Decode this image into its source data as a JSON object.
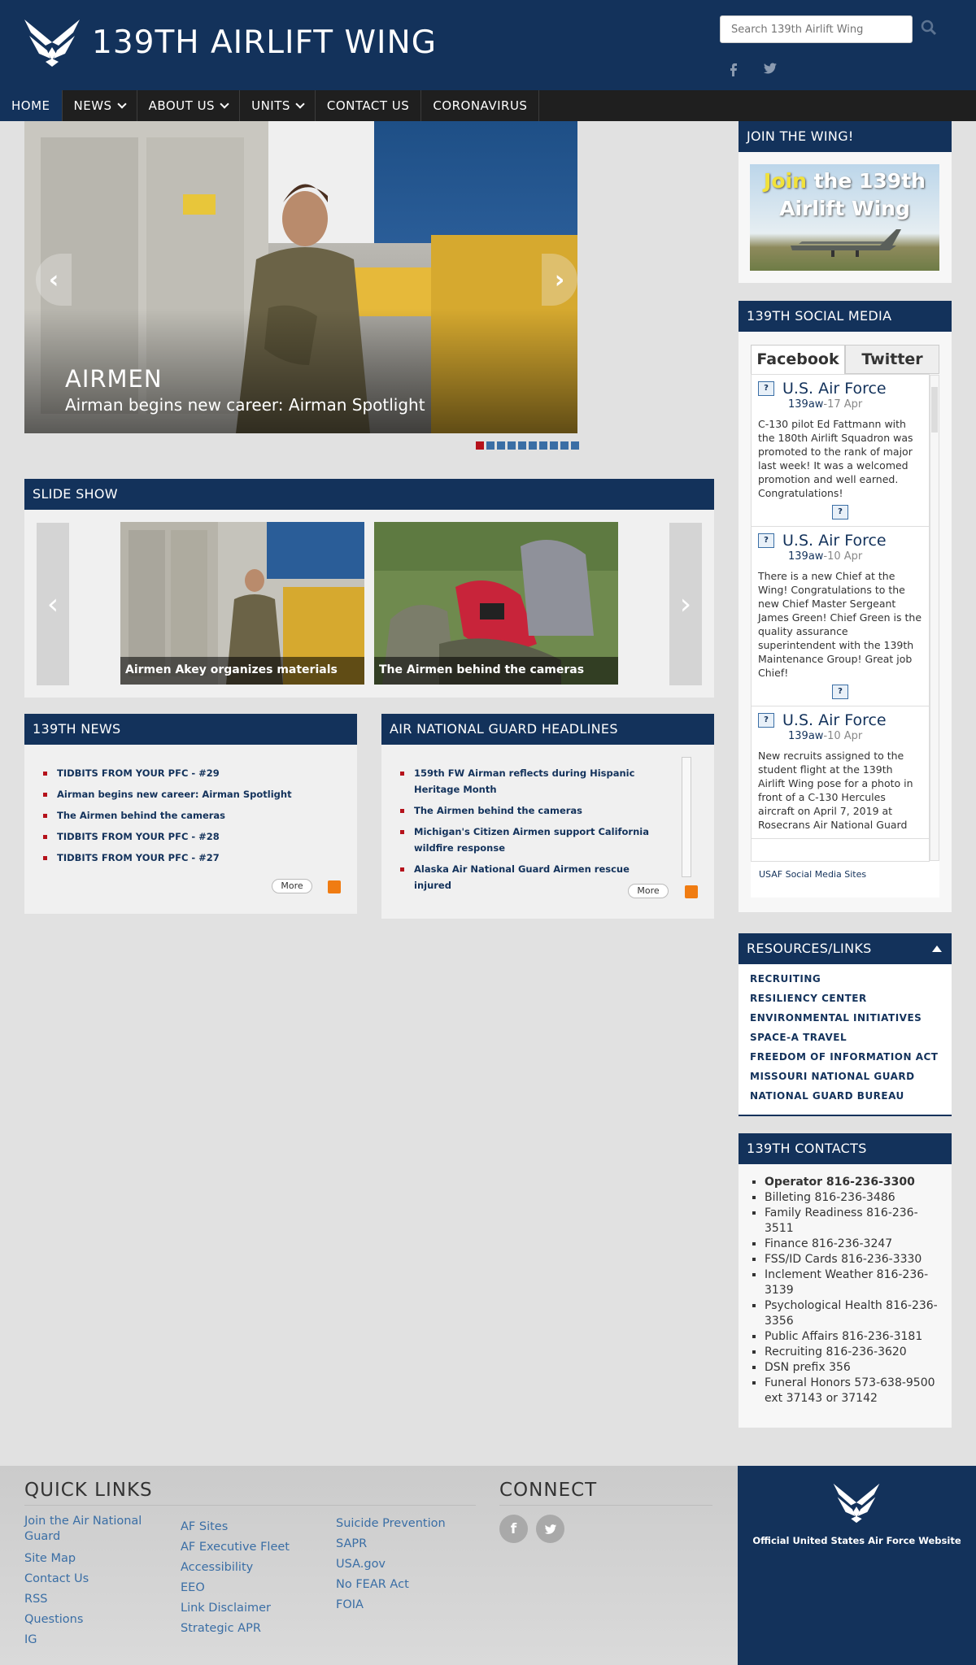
{
  "header": {
    "site_title": "139TH AIRLIFT WING",
    "search_placeholder": "Search 139th Airlift Wing"
  },
  "nav": {
    "items": [
      {
        "label": "HOME",
        "active": true
      },
      {
        "label": "NEWS",
        "dropdown": true
      },
      {
        "label": "ABOUT US",
        "dropdown": true
      },
      {
        "label": "UNITS",
        "dropdown": true
      },
      {
        "label": "CONTACT US"
      },
      {
        "label": "CORONAVIRUS"
      }
    ]
  },
  "hero": {
    "category": "AIRMEN",
    "caption": "Airman begins new career: Airman Spotlight",
    "slide_count": 10,
    "active_slide": 1
  },
  "slideshow": {
    "title": "SLIDE SHOW",
    "slides": [
      {
        "caption": "Airmen Akey organizes materials"
      },
      {
        "caption": "The Airmen behind the cameras"
      }
    ]
  },
  "news": {
    "title": "139TH NEWS",
    "items": [
      "TIDBITS FROM YOUR PFC - #29",
      "Airman begins new career: Airman Spotlight",
      "The Airmen behind the cameras",
      "TIDBITS FROM YOUR PFC - #28",
      "TIDBITS FROM YOUR PFC - #27"
    ],
    "more_label": "More"
  },
  "headlines": {
    "title": "AIR NATIONAL GUARD HEADLINES",
    "items": [
      "159th FW Airman reflects during Hispanic Heritage Month",
      "The Airmen behind the cameras",
      "Michigan's Citizen Airmen support California wildfire response",
      "Alaska Air National Guard Airmen rescue injured"
    ],
    "more_label": "More"
  },
  "join": {
    "title": "JOIN THE WING!",
    "banner_line1_highlight": "Join",
    "banner_line1_rest": " the 139th",
    "banner_line2": "Airlift Wing"
  },
  "social": {
    "title": "139TH SOCIAL MEDIA",
    "tabs": [
      "Facebook",
      "Twitter"
    ],
    "posts": [
      {
        "author": "U.S. Air Force",
        "handle": "139aw",
        "date": "-17 Apr",
        "text": "C-130 pilot Ed Fattmann with the 180th Airlift Squadron was promoted to the rank of major last week! It was a welcomed promotion and well earned. Congratulations!"
      },
      {
        "author": "U.S. Air Force",
        "handle": "139aw",
        "date": "-10 Apr",
        "text": "There is a new Chief at the Wing! Congratulations to the new Chief Master Sergeant James Green! Chief Green is the quality assurance superintendent with the 139th Maintenance Group! Great job Chief!"
      },
      {
        "author": "U.S. Air Force",
        "handle": "139aw",
        "date": "-10 Apr",
        "text": "New recruits assigned to the student flight at the 139th Airlift Wing pose for a photo in front of a C-130 Hercules aircraft on April 7, 2019 at Rosecrans Air National Guard"
      }
    ],
    "footer_link": "USAF Social Media Sites"
  },
  "resources": {
    "title": "RESOURCES/LINKS",
    "links": [
      "RECRUITING",
      "RESILIENCY CENTER",
      "ENVIRONMENTAL INITIATIVES",
      "SPACE-A TRAVEL",
      "FREEDOM OF INFORMATION ACT",
      "MISSOURI NATIONAL GUARD",
      "NATIONAL GUARD BUREAU"
    ]
  },
  "contacts": {
    "title": "139TH CONTACTS",
    "items": [
      "Operator 816-236-3300",
      "Billeting 816-236-3486",
      "Family Readiness 816-236-3511",
      "Finance 816-236-3247",
      "FSS/ID Cards 816-236-3330",
      "Inclement Weather 816-236-3139",
      "Psychological Health 816-236-3356",
      "Public Affairs 816-236-3181",
      "Recruiting 816-236-3620",
      "DSN prefix 356",
      "Funeral Honors 573-638-9500 ext 37143 or 37142"
    ]
  },
  "footer": {
    "quick_links_title": "QUICK LINKS",
    "connect_title": "CONNECT",
    "col1": [
      "Join the Air National Guard",
      "Site Map",
      "Contact Us",
      "RSS",
      "Questions",
      "IG"
    ],
    "col2": [
      "AF Sites",
      "AF Executive Fleet",
      "Accessibility",
      "EEO",
      "Link Disclaimer",
      "Strategic APR"
    ],
    "col3": [
      "Suicide Prevention",
      "SAPR",
      "USA.gov",
      "No FEAR Act",
      "FOIA"
    ],
    "badge_text": "Official United States Air Force Website"
  },
  "colors": {
    "navy": "#13325b",
    "accent_red": "#b5121b",
    "link_blue": "#3a6ea5"
  }
}
